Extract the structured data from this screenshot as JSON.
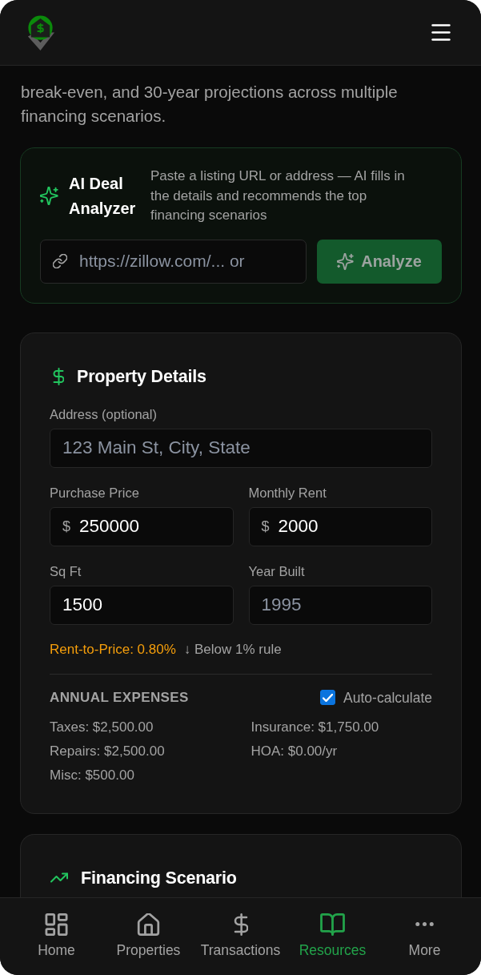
{
  "intro": "break-even, and 30-year projections across multiple financing scenarios.",
  "ai_analyzer": {
    "title": "AI Deal Analyzer",
    "description": "Paste a listing URL or address — AI fills in the details and recommends the top financing scenarios",
    "input": {
      "placeholder": "https://zillow.com/... or"
    },
    "button": {
      "label": "Analyze",
      "disabled": true
    }
  },
  "property_details": {
    "title": "Property Details",
    "field_rows": [
      {
        "fields": [
          {
            "label": "Address (optional)",
            "placeholder": "123 Main St, City, State"
          }
        ]
      },
      {
        "fields": [
          {
            "label": "Purchase Price",
            "prefix": "$",
            "value": "250000"
          },
          {
            "label": "Monthly Rent",
            "prefix": "$",
            "value": "2000"
          }
        ]
      },
      {
        "fields": [
          {
            "label": "Sq Ft",
            "value": "1500"
          },
          {
            "label": "Year Built",
            "placeholder": "1995"
          }
        ]
      }
    ],
    "ratio": {
      "text": "Rent-to-Price: 0.80%",
      "note": "↓ Below 1% rule",
      "meets_rule": false
    },
    "expenses": {
      "title": "ANNUAL EXPENSES",
      "auto_calculate": {
        "label": "Auto-calculate",
        "checked": true
      },
      "items": [
        "Taxes: $2,500.00",
        "Insurance: $1,750.00",
        "Repairs: $2,500.00",
        "HOA: $0.00/yr",
        "Misc: $500.00"
      ]
    }
  },
  "financing": {
    "title": "Financing Scenario"
  },
  "nav": {
    "items": [
      {
        "label": "Home",
        "selected": false
      },
      {
        "label": "Properties",
        "selected": false
      },
      {
        "label": "Transactions",
        "selected": false
      },
      {
        "label": "Resources",
        "selected": true
      },
      {
        "label": "More",
        "selected": false
      }
    ]
  }
}
